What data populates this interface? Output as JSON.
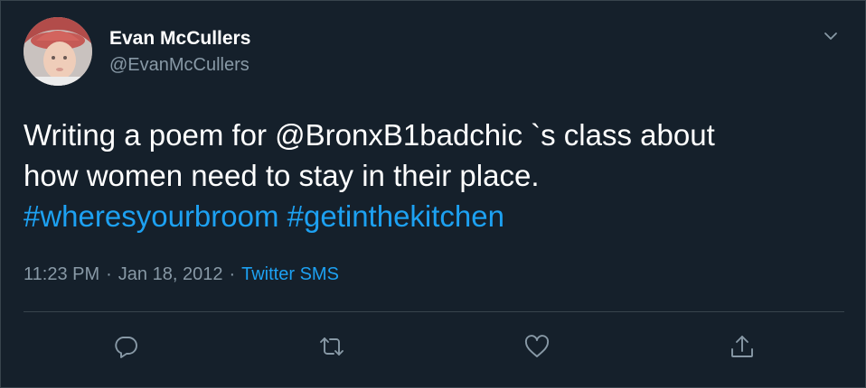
{
  "tweet": {
    "author_name": "Evan McCullers",
    "author_handle": "@EvanMcCullers",
    "text_line1": "Writing a poem for @BronxB1badchic `s class about",
    "text_line2": "how women need to stay in their place.",
    "hashtag1": "#wheresyourbroom",
    "hashtag2": "#getinthekitchen",
    "time": "11:23 PM",
    "date": "Jan 18, 2012",
    "separator": "·",
    "source": "Twitter SMS"
  },
  "actions": [
    "reply-icon",
    "retweet-icon",
    "like-icon",
    "share-icon"
  ],
  "colors": {
    "background": "#15202b",
    "border": "#38444d",
    "link": "#1da1f2",
    "secondary_text": "#8899a6",
    "icon": "#8899a6"
  }
}
